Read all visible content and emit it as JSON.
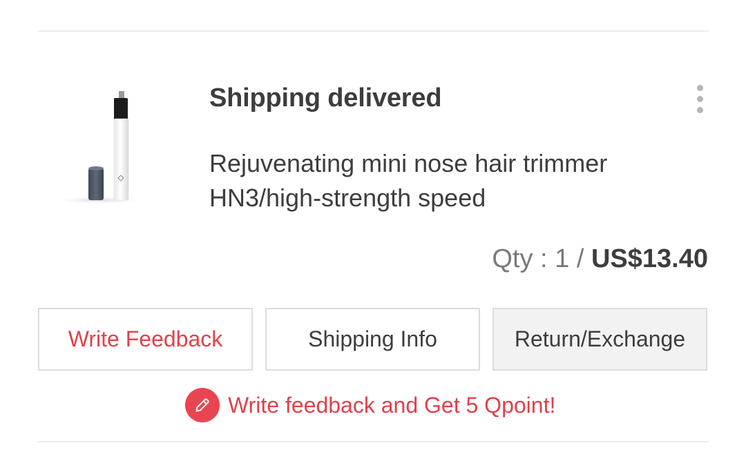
{
  "order": {
    "status": "Shipping delivered",
    "product_name": "Rejuvenating mini nose hair trimmer HN3/high-strength speed",
    "qty_text": "Qty : 1 / ",
    "price": "US$13.40"
  },
  "actions": {
    "write_feedback": "Write Feedback",
    "shipping_info": "Shipping Info",
    "return_exchange": "Return/Exchange"
  },
  "promo": {
    "text": "Write feedback and Get 5 Qpoint!",
    "icon": "pencil-icon"
  },
  "menu": {
    "icon": "more-vertical-icon"
  },
  "colors": {
    "accent": "#e2404a",
    "text": "#3d3d3d",
    "muted": "#7a7a7a",
    "border": "#dcdcdc"
  }
}
